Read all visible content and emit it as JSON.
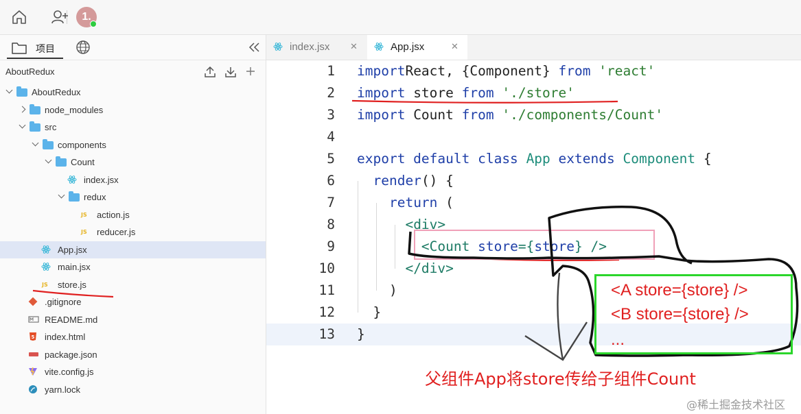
{
  "topbar": {
    "icons": [
      "home-icon",
      "add-user-icon"
    ],
    "avatar_text": "1."
  },
  "sidebar": {
    "tab_project": "项目",
    "project_name": "AboutRedux",
    "tree": [
      {
        "label": "AboutRedux",
        "type": "folder",
        "depth": 0,
        "expanded": true
      },
      {
        "label": "node_modules",
        "type": "folder",
        "depth": 1,
        "expanded": false
      },
      {
        "label": "src",
        "type": "folder",
        "depth": 1,
        "expanded": true
      },
      {
        "label": "components",
        "type": "folder",
        "depth": 2,
        "expanded": true
      },
      {
        "label": "Count",
        "type": "folder",
        "depth": 3,
        "expanded": true
      },
      {
        "label": "index.jsx",
        "type": "react",
        "depth": 4
      },
      {
        "label": "redux",
        "type": "folder",
        "depth": 4,
        "expanded": true
      },
      {
        "label": "action.js",
        "type": "js",
        "depth": 5
      },
      {
        "label": "reducer.js",
        "type": "js",
        "depth": 5
      },
      {
        "label": "App.jsx",
        "type": "react",
        "depth": 2,
        "selected": true
      },
      {
        "label": "main.jsx",
        "type": "react",
        "depth": 2
      },
      {
        "label": "store.js",
        "type": "js",
        "depth": 2
      },
      {
        "label": ".gitignore",
        "type": "git",
        "depth": 1
      },
      {
        "label": "README.md",
        "type": "md",
        "depth": 1
      },
      {
        "label": "index.html",
        "type": "html",
        "depth": 1
      },
      {
        "label": "package.json",
        "type": "json",
        "depth": 1
      },
      {
        "label": "vite.config.js",
        "type": "vite",
        "depth": 1
      },
      {
        "label": "yarn.lock",
        "type": "yarn",
        "depth": 1
      }
    ]
  },
  "tabs": [
    {
      "label": "index.jsx",
      "active": false
    },
    {
      "label": "App.jsx",
      "active": true
    }
  ],
  "code_lines": [
    {
      "n": "1",
      "tokens": [
        [
          "kw",
          "import"
        ],
        [
          "",
          "React, {Component} "
        ],
        [
          "kw",
          "from"
        ],
        [
          "",
          " "
        ],
        [
          "str",
          "'react'"
        ]
      ]
    },
    {
      "n": "2",
      "tokens": [
        [
          "kw",
          "import"
        ],
        [
          "",
          " store "
        ],
        [
          "kw",
          "from"
        ],
        [
          "",
          " "
        ],
        [
          "str",
          "'./store'"
        ]
      ]
    },
    {
      "n": "3",
      "tokens": [
        [
          "kw",
          "import"
        ],
        [
          "",
          " Count "
        ],
        [
          "kw",
          "from"
        ],
        [
          "",
          " "
        ],
        [
          "str",
          "'./components/Count'"
        ]
      ]
    },
    {
      "n": "4",
      "tokens": []
    },
    {
      "n": "5",
      "tokens": [
        [
          "kw",
          "export default class"
        ],
        [
          "",
          " "
        ],
        [
          "cls",
          "App"
        ],
        [
          "",
          " "
        ],
        [
          "kw",
          "extends"
        ],
        [
          "",
          " "
        ],
        [
          "cls",
          "Component"
        ],
        [
          "",
          " {"
        ]
      ]
    },
    {
      "n": "6",
      "tokens": [
        [
          "",
          "  "
        ],
        [
          "kw",
          "render"
        ],
        [
          "",
          "() {"
        ]
      ]
    },
    {
      "n": "7",
      "tokens": [
        [
          "",
          "    "
        ],
        [
          "kw",
          "return"
        ],
        [
          "",
          " ("
        ]
      ]
    },
    {
      "n": "8",
      "tokens": [
        [
          "",
          "      "
        ],
        [
          "tg",
          "<div>"
        ]
      ]
    },
    {
      "n": "9",
      "tokens": [
        [
          "",
          "        "
        ],
        [
          "tg",
          "<Count"
        ],
        [
          "",
          " "
        ],
        [
          "kw",
          "store"
        ],
        [
          "tg",
          "={"
        ],
        [
          "kw",
          "store"
        ],
        [
          "tg",
          "}"
        ],
        [
          "",
          " "
        ],
        [
          "tg",
          "/>"
        ]
      ]
    },
    {
      "n": "10",
      "tokens": [
        [
          "",
          "      "
        ],
        [
          "tg",
          "</div>"
        ]
      ]
    },
    {
      "n": "11",
      "tokens": [
        [
          "",
          "    )"
        ]
      ]
    },
    {
      "n": "12",
      "tokens": [
        [
          "",
          "  }"
        ]
      ]
    },
    {
      "n": "13",
      "tokens": [
        [
          "",
          "}"
        ]
      ]
    }
  ],
  "annotation": {
    "box_lines": [
      "<A store={store} />",
      "<B store={store} />",
      "..."
    ],
    "caption": "父组件App将store传给子组件Count"
  },
  "watermark": "@稀土掘金技术社区",
  "colors": {
    "annotation_red": "#e02020",
    "annotation_green": "#2bd62b",
    "selection": "#dfe6f5"
  }
}
